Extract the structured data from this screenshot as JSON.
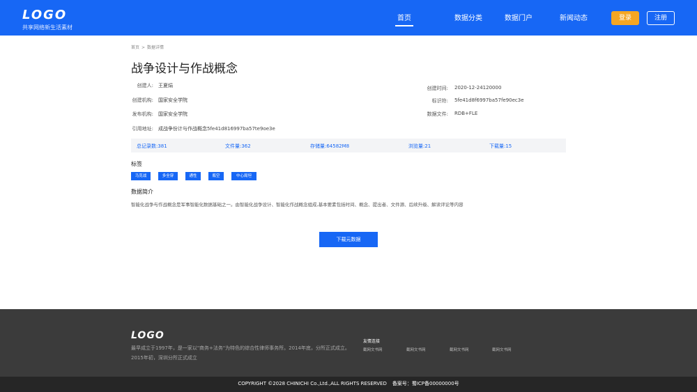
{
  "header": {
    "logo": "LOGO",
    "logo_sub": "共享网络新生活素材",
    "nav": [
      "首页",
      "数据分类",
      "数据门户",
      "新闻动态"
    ],
    "login": "登录",
    "register": "注册"
  },
  "breadcrumb": [
    "首页",
    ">",
    "数据详情"
  ],
  "title": "战争设计与作战概念",
  "fields_left": [
    {
      "label": "创建人:",
      "value": "王夏绢"
    },
    {
      "label": "创建机构:",
      "value": "国家安全学院"
    },
    {
      "label": "发布机构:",
      "value": "国家安全学院"
    },
    {
      "label": "引用地址:",
      "value": "成战争份计与作战概念5fe41d816997ba57te9oe3e"
    }
  ],
  "fields_right": [
    {
      "label": "创建时间:",
      "value": "2020-12-24120000"
    },
    {
      "label": "标识符:",
      "value": "5fe41d8f6997ba57fe90ec3e"
    },
    {
      "label": "数据文件:",
      "value": "RDB+FLE"
    }
  ],
  "stats": [
    "总记录数:381",
    "文件量:362",
    "存储量:64582M8",
    "浏览量:21",
    "下载量:15"
  ],
  "tags_title": "标签",
  "tags": [
    "马克战",
    "多全穿",
    "通性",
    "瓶空",
    "中心局坦"
  ],
  "intro_title": "数据简介",
  "intro_text": "智能化战争与作战概念是军事智能化数据基础之一。由智能化战争设计、智能化作战概念组成,基本要素包括时间、概念、提出者、文件源、后续升级、解读评论等内容",
  "download_button": "下载元数据",
  "footer": {
    "logo": "LOGO",
    "desc": "最早成立于1997年，是一家以\"商务+法务\"为特色的综合性律师事务所。2014年底，分所正式成立。2015年初，深圳分所正式成立",
    "links_title": "友情连接",
    "links": [
      "截网文书网",
      "截网文书网",
      "截网文书网",
      "截网文书网"
    ],
    "copyright": "COPYRIGHT ©2028 CHINICHI Co.,Ltd.,ALL RIGHTS RESERVED",
    "icp": "备案号：蜀ICP备00000000号"
  },
  "colors": {
    "primary": "#1767f5",
    "accent": "#f5a623",
    "footer": "#3b3b3b",
    "footer_bottom": "#262626"
  }
}
